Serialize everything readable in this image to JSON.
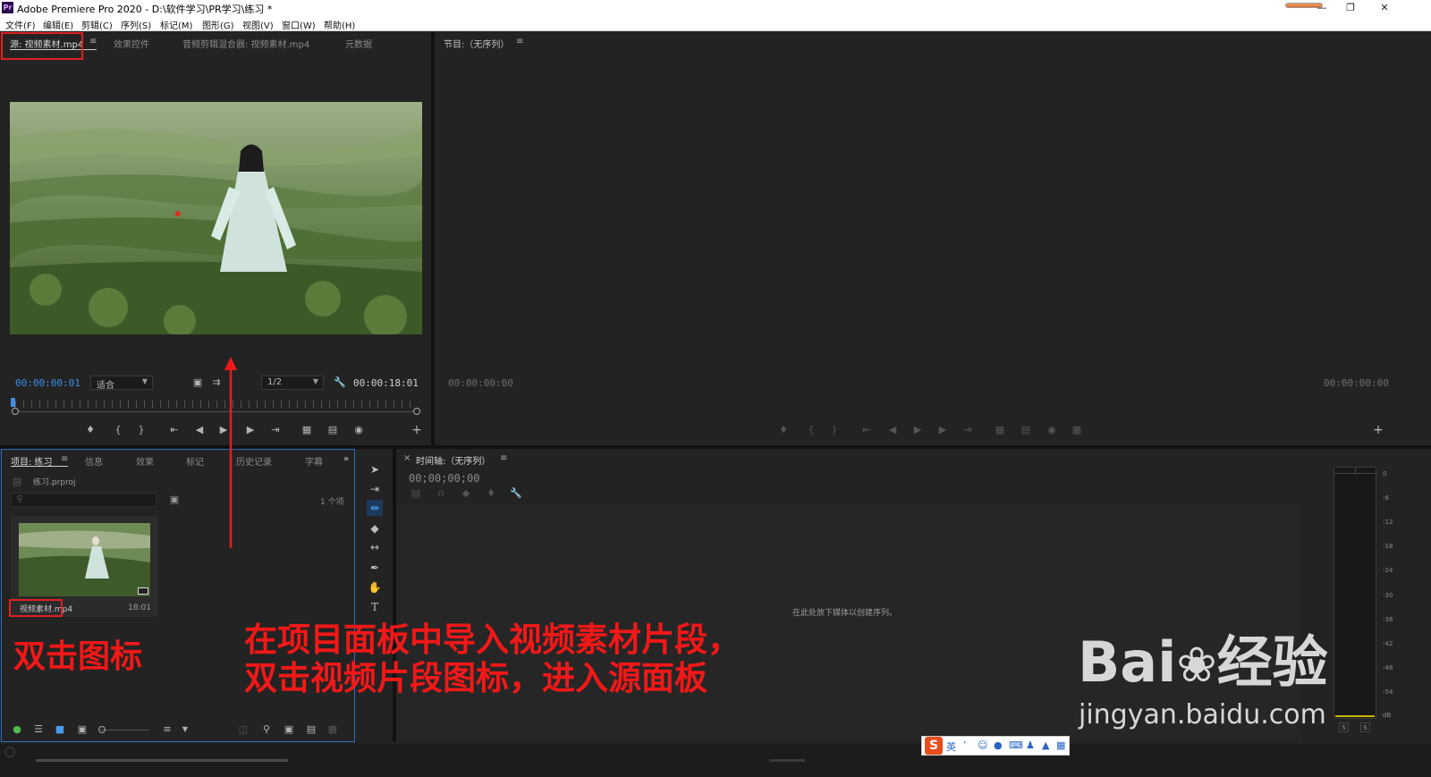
{
  "window": {
    "app_icon": "Pr",
    "title": "Adobe Premiere Pro 2020 - D:\\软件学习\\PR学习\\练习 *",
    "controls": [
      "minimize-icon",
      "restore-icon",
      "close-icon"
    ]
  },
  "menubar": [
    "文件(F)",
    "编辑(E)",
    "剪辑(C)",
    "序列(S)",
    "标记(M)",
    "图形(G)",
    "视图(V)",
    "窗口(W)",
    "帮助(H)"
  ],
  "source_panel": {
    "tabs": [
      "源: 视频素材.mp4",
      "效果控件",
      "音频剪辑混合器: 视频素材.mp4",
      "元数据"
    ],
    "menu_icon": "≡",
    "timecode_current": "00:00:00:01",
    "zoom_value": "适合",
    "resolution_value": "1/2",
    "timecode_duration": "00:00:18:01"
  },
  "program_panel": {
    "title": "节目:（无序列）",
    "menu_icon": "≡",
    "timecode_left": "00:00:00:00",
    "timecode_right": "00:00:00:00"
  },
  "project_panel": {
    "tabs": [
      "项目: 练习",
      "信息",
      "效果",
      "标记",
      "历史记录",
      "字幕"
    ],
    "menu_icon": "≡",
    "more_icon": "»",
    "project_file": "练习.prproj",
    "search_placeholder": "",
    "item_count": "1 个项",
    "clip": {
      "name_part1": "视频素材",
      "name_part2": ".mp4",
      "duration": "18:01"
    }
  },
  "timeline_panel": {
    "close_icon": "×",
    "title": "时间轴:（无序列）",
    "menu_icon": "≡",
    "timecode": "00;00;00;00",
    "empty_hint": "在此处放下媒体以创建序列。"
  },
  "audio_meter": {
    "labels": [
      "0",
      "-6",
      "-12",
      "-18",
      "-24",
      "-30",
      "-36",
      "-42",
      "-48",
      "-54",
      "dB"
    ],
    "solo_labels": [
      "S",
      "S"
    ]
  },
  "annotations": {
    "left_label": "双击图标",
    "main_line1": "在项目面板中导入视频素材片段，",
    "main_line2": "双击视频片段图标，进入源面板"
  },
  "ime_bar": {
    "logo": "S",
    "lang": "英",
    "items": [
      "punctuation-icon",
      "emoji-icon",
      "microphone-icon",
      "keyboard-icon",
      "user-icon",
      "shirt-icon",
      "grid-icon"
    ]
  },
  "watermark": {
    "brand": "Bai",
    "brand2": "经验",
    "url": "jingyan.baidu.com"
  },
  "colors": {
    "accent_blue": "#3d8ee8",
    "annotation_red": "#f21818",
    "panel_bg": "#232323"
  }
}
